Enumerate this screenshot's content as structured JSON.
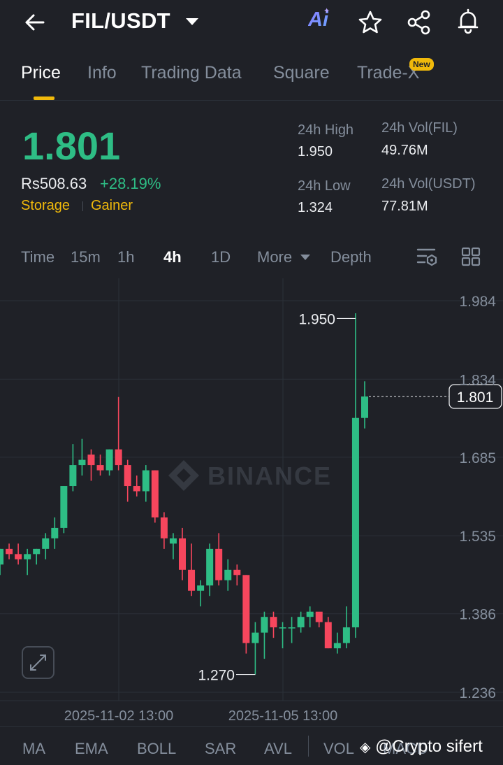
{
  "header": {
    "pair": "FIL/USDT",
    "ai_label": "Ai",
    "icons": [
      "back-arrow-icon",
      "dropdown-caret-icon",
      "ai-icon",
      "star-icon",
      "share-icon",
      "bell-icon"
    ]
  },
  "tabs": [
    {
      "label": "Price",
      "active": true
    },
    {
      "label": "Info"
    },
    {
      "label": "Trading Data"
    },
    {
      "label": "Square"
    },
    {
      "label": "Trade-X",
      "badge": "New"
    }
  ],
  "price": {
    "last": "1.801",
    "inr": "Rs508.63",
    "change": "+28.19%",
    "tags": [
      "Storage",
      "Gainer"
    ]
  },
  "stats": {
    "high_label": "24h High",
    "high": "1.950",
    "low_label": "24h Low",
    "low": "1.324",
    "vol_fil_label": "24h Vol(FIL)",
    "vol_fil": "49.76M",
    "vol_usdt_label": "24h Vol(USDT)",
    "vol_usdt": "77.81M"
  },
  "intervals": {
    "items": [
      "Time",
      "15m",
      "1h",
      "4h",
      "1D",
      "More",
      "Depth"
    ],
    "active": "4h"
  },
  "chart": {
    "watermark": "BINANCE",
    "y_ticks": [
      "1.984",
      "1.834",
      "1.685",
      "1.535",
      "1.386",
      "1.236"
    ],
    "x_ticks": [
      "2025-11-02 13:00",
      "2025-11-05 13:00"
    ],
    "high_marker": "1.950",
    "low_marker": "1.270",
    "current_price": "1.801",
    "colors": {
      "up": "#2ebd85",
      "down": "#f6465d",
      "bg": "#1f2127",
      "grid": "#2b3139"
    }
  },
  "chart_data": {
    "type": "candlestick",
    "ylim": [
      1.236,
      1.984
    ],
    "yticks": [
      1.984,
      1.834,
      1.685,
      1.535,
      1.386,
      1.236
    ],
    "candles": [
      [
        1.48,
        1.51,
        1.46,
        1.51
      ],
      [
        1.51,
        1.52,
        1.49,
        1.5
      ],
      [
        1.5,
        1.52,
        1.48,
        1.49
      ],
      [
        1.49,
        1.51,
        1.46,
        1.5
      ],
      [
        1.5,
        1.51,
        1.48,
        1.51
      ],
      [
        1.51,
        1.54,
        1.49,
        1.53
      ],
      [
        1.53,
        1.57,
        1.51,
        1.55
      ],
      [
        1.55,
        1.63,
        1.54,
        1.63
      ],
      [
        1.63,
        1.71,
        1.62,
        1.67
      ],
      [
        1.67,
        1.72,
        1.65,
        1.68
      ],
      [
        1.69,
        1.7,
        1.64,
        1.67
      ],
      [
        1.67,
        1.69,
        1.65,
        1.66
      ],
      [
        1.66,
        1.7,
        1.65,
        1.7
      ],
      [
        1.7,
        1.8,
        1.66,
        1.67
      ],
      [
        1.67,
        1.68,
        1.6,
        1.63
      ],
      [
        1.63,
        1.65,
        1.61,
        1.62
      ],
      [
        1.62,
        1.67,
        1.6,
        1.66
      ],
      [
        1.66,
        1.66,
        1.56,
        1.57
      ],
      [
        1.57,
        1.58,
        1.51,
        1.53
      ],
      [
        1.52,
        1.54,
        1.49,
        1.53
      ],
      [
        1.53,
        1.55,
        1.45,
        1.47
      ],
      [
        1.47,
        1.52,
        1.42,
        1.43
      ],
      [
        1.43,
        1.45,
        1.4,
        1.44
      ],
      [
        1.44,
        1.52,
        1.42,
        1.51
      ],
      [
        1.51,
        1.54,
        1.44,
        1.45
      ],
      [
        1.45,
        1.49,
        1.43,
        1.47
      ],
      [
        1.47,
        1.48,
        1.44,
        1.46
      ],
      [
        1.46,
        1.46,
        1.31,
        1.33
      ],
      [
        1.33,
        1.37,
        1.27,
        1.35
      ],
      [
        1.35,
        1.39,
        1.3,
        1.38
      ],
      [
        1.38,
        1.39,
        1.34,
        1.36
      ],
      [
        1.36,
        1.37,
        1.32,
        1.36
      ],
      [
        1.36,
        1.38,
        1.33,
        1.36
      ],
      [
        1.36,
        1.39,
        1.35,
        1.38
      ],
      [
        1.38,
        1.4,
        1.36,
        1.39
      ],
      [
        1.39,
        1.38,
        1.36,
        1.37
      ],
      [
        1.37,
        1.38,
        1.32,
        1.32
      ],
      [
        1.32,
        1.35,
        1.31,
        1.33
      ],
      [
        1.33,
        1.4,
        1.32,
        1.36
      ],
      [
        1.36,
        1.96,
        1.34,
        1.76
      ],
      [
        1.76,
        1.83,
        1.74,
        1.801
      ]
    ]
  },
  "indicators": [
    "MA",
    "EMA",
    "BOLL",
    "SAR",
    "AVL",
    "VOL",
    "MACD"
  ],
  "watermark_credit": "@Crypto sifert"
}
